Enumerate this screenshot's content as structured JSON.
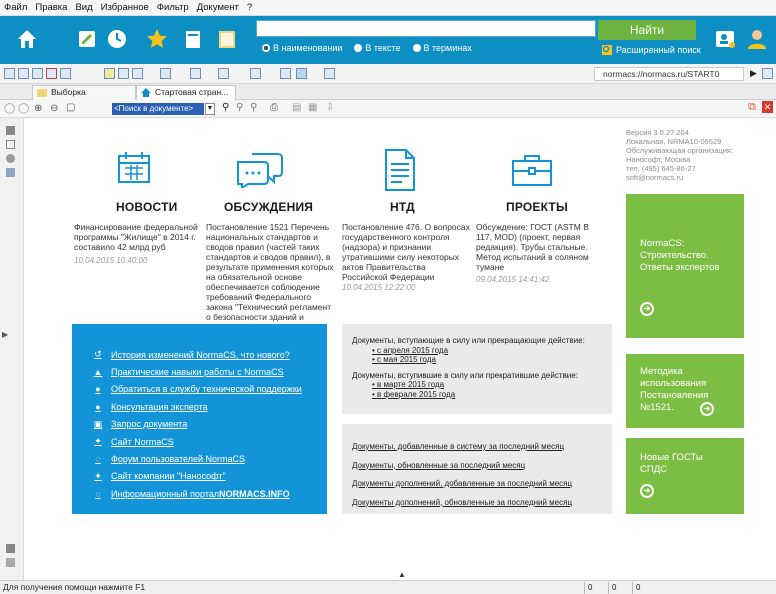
{
  "menu": [
    "Файл",
    "Правка",
    "Вид",
    "Избранное",
    "Фильтр",
    "Документ",
    "?"
  ],
  "search": {
    "value": "",
    "options": [
      "В наименовании",
      "В тексте",
      "В терминах"
    ],
    "selected": 0,
    "find_label": "Найти",
    "advanced_label": "Расширенный поиск"
  },
  "address": "normacs://normacs.ru/START0",
  "tabs": [
    "Выборка документов",
    "Стартовая стран..."
  ],
  "doc_search_placeholder": "<Поиск в документе>",
  "sections": [
    {
      "title": "НОВОСТИ",
      "icon": "calendar-icon",
      "body": "Финансирование федеральной программы \"Жилище\" в 2014 г. составило 42 млрд руб",
      "date": "10.04.2015 10:40:00"
    },
    {
      "title": "ОБСУЖДЕНИЯ",
      "icon": "chat-bubbles-icon",
      "body": "Постановление 1521 Перечень национальных стандартов и сводов правил (частей таких стандартов и сводов правил), в результате применения которых на обязательной основе обеспечивается соблюдение требований Федерального закона \"Технический регламент о безопасности зданий и сооружений\"",
      "date": ""
    },
    {
      "title": "НТД",
      "icon": "document-icon",
      "body": "Постановление 476. О вопросах государственного контроля (надзора) и признании утратившими силу некоторых актов Правительства Российской Федерации",
      "date": "10.04.2015 12:22:00"
    },
    {
      "title": "ПРОЕКТЫ",
      "icon": "briefcase-icon",
      "body": "Обсуждение: ГОСТ (ASTM В 117, MOD) (проект, первая редакция). Трубы стальные. Метод испытаний в соляном тумане",
      "date": "09.04.2015 14:41:42"
    }
  ],
  "version": {
    "lines": [
      "Версия 3.0.27.204",
      "Локальная, NRMA10-06529",
      "Обслуживающая организация:",
      "Нанософт, Москва",
      "тел. (495) 645-86-27",
      "soft@normacs.ru"
    ]
  },
  "green_cards": [
    {
      "label": "NormaCS: Строительство. Ответы экспертов"
    },
    {
      "label": "Методика использования Постановления №1521."
    },
    {
      "label": "Новые ГОСТы СПДС"
    }
  ],
  "blue_links": [
    {
      "icon": "history-icon",
      "text": "История изменений NormaCS, что нового?",
      "bold": ""
    },
    {
      "icon": "graduation-cap-icon",
      "text": "Практические навыки работы с NormaCS",
      "bold": ""
    },
    {
      "icon": "user-icon",
      "text": "Обратиться в службу технической поддержки",
      "bold": ""
    },
    {
      "icon": "chat-icon",
      "text": "Консультация эксперта",
      "bold": ""
    },
    {
      "icon": "request-document-icon",
      "text": "Запрос документа",
      "bold": ""
    },
    {
      "icon": "star-icon",
      "text": "Сайт NormaCS",
      "bold": ""
    },
    {
      "icon": "forum-icon",
      "text": "Форум пользователей NormaCS",
      "bold": ""
    },
    {
      "icon": "star-icon",
      "text": "Сайт компании \"Нанософт\"",
      "bold": ""
    },
    {
      "icon": "forum-icon",
      "text": "Информационный портал ",
      "bold": "NORMACS.INFO"
    }
  ],
  "gray_panel_1": {
    "heading1": "Документы, вступающие в силу или прекращающие действие:",
    "items1": [
      "с апреля 2015 года",
      "с мая 2015 года"
    ],
    "heading2": "Документы, вступившие в силу или прекратившие действие:",
    "items2": [
      "в марте 2015 года",
      "в феврале 2015 года"
    ]
  },
  "gray_panel_2": {
    "links": [
      "Документы, добавленные в систему за последний месяц",
      "Документы, обновленные за последний месяц",
      "Документы дополнений, добавленные за последний месяц",
      "Документы дополнений, обновленные за последний месяц"
    ]
  },
  "status": {
    "help": "Для получения помощи нажмите F1",
    "cells": [
      "0",
      "0",
      "0"
    ]
  }
}
